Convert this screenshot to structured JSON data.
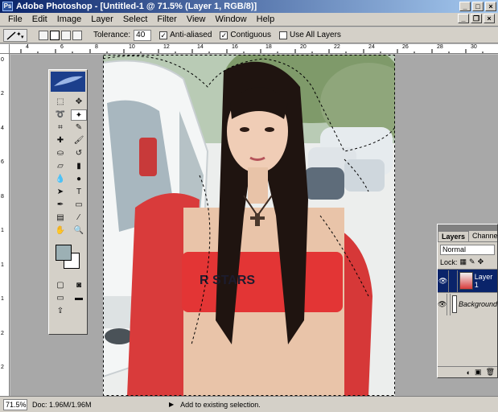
{
  "window": {
    "title": "Adobe Photoshop - [Untitled-1 @ 71.5% (Layer 1, RGB/8)]"
  },
  "menubar": {
    "items": [
      "File",
      "Edit",
      "Image",
      "Layer",
      "Select",
      "Filter",
      "View",
      "Window",
      "Help"
    ]
  },
  "options": {
    "tolerance_label": "Tolerance:",
    "tolerance_value": "40",
    "anti_aliased": "Anti-aliased",
    "contiguous": "Contiguous",
    "use_all_layers": "Use All Layers"
  },
  "ruler": {
    "top": [
      "4",
      "6",
      "8",
      "10",
      "12",
      "14",
      "16",
      "18",
      "20",
      "22",
      "24",
      "26",
      "28",
      "30"
    ],
    "left": [
      "0",
      "2",
      "4",
      "6",
      "8",
      "1",
      "1",
      "1",
      "2",
      "2"
    ]
  },
  "photo": {
    "shirt_text": "R STARS"
  },
  "layers_panel": {
    "tabs": [
      "Layers",
      "Channels"
    ],
    "blend_mode": "Normal",
    "lock_label": "Lock:",
    "layers": [
      {
        "name": "Layer 1",
        "selected": true
      },
      {
        "name": "Background",
        "selected": false
      }
    ]
  },
  "status": {
    "zoom": "71.5%",
    "doc": "Doc: 1.96M/1.96M",
    "message": "Add to existing selection."
  },
  "colors": {
    "foreground": "#9cb0b4",
    "background": "#ffffff",
    "title_bar": "#0a246a"
  }
}
